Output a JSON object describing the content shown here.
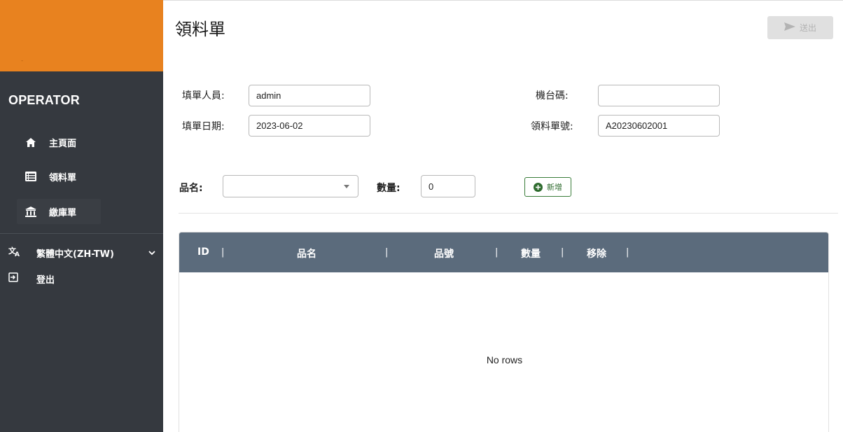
{
  "sidebar": {
    "brand_mark": "-",
    "role": "OPERATOR",
    "nav": [
      {
        "label": "主頁面",
        "icon": "home-icon"
      },
      {
        "label": "領料單",
        "icon": "list-icon"
      },
      {
        "label": "繳庫單",
        "icon": "bank-icon"
      }
    ],
    "language": {
      "label": "繁體中文(ZH-TW)",
      "icon": "translate-icon"
    },
    "logout": {
      "label": "登出",
      "icon": "logout-icon"
    }
  },
  "header": {
    "title": "領料單",
    "submit_label": "送出"
  },
  "form": {
    "filler_label": "填單人員:",
    "filler_value": "admin",
    "date_label": "填單日期:",
    "date_value": "2023-06-02",
    "machine_label": "機台碼:",
    "machine_value": "",
    "order_no_label": "領料單號:",
    "order_no_value": "A20230602001",
    "item_label": "品名:",
    "item_value": "",
    "qty_label": "數量:",
    "qty_value": "0",
    "add_label": "新增"
  },
  "grid": {
    "columns": [
      "ID",
      "品名",
      "品號",
      "數量",
      "移除"
    ],
    "empty_text": "No rows"
  },
  "colors": {
    "brand": "#e8821f",
    "sidebar": "#35393f",
    "grid_header": "#5b6b7c",
    "add_button": "#3a7d3a"
  }
}
